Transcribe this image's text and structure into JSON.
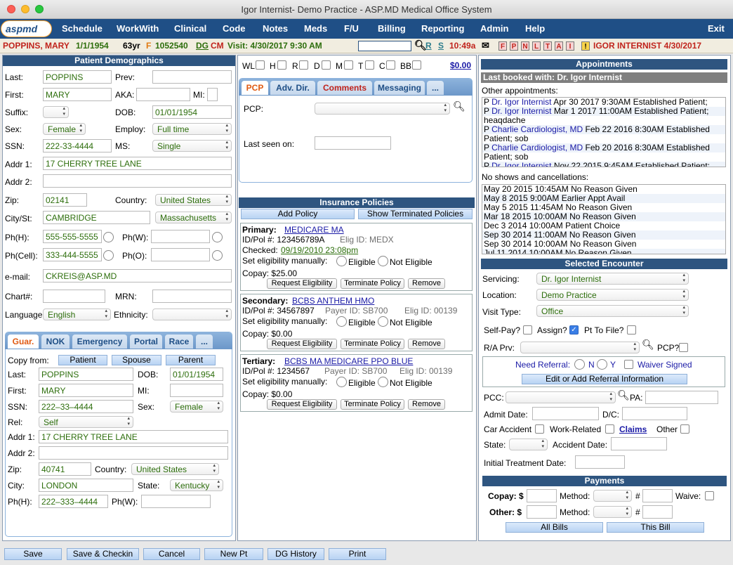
{
  "window": {
    "title": "Igor Internist- Demo Practice - ASP.MD Medical Office System"
  },
  "logo": {
    "text": "aspmd"
  },
  "nav": {
    "items": [
      "Schedule",
      "WorkWith",
      "Clinical",
      "Code",
      "Notes",
      "Meds",
      "F/U",
      "Billing",
      "Reporting",
      "Admin",
      "Help"
    ],
    "exit": "Exit"
  },
  "patient_strip": {
    "name": "POPPINS, MARY",
    "dob": "1/1/1954",
    "age": "63yr",
    "sex": "F",
    "id": "1052540",
    "dg": "DG",
    "cm": "CM",
    "visit": "Visit: 4/30/2017 9:30 AM",
    "r": "R",
    "s": "S",
    "time": "10:49a",
    "flags": [
      "F",
      "P",
      "N",
      "L",
      "T",
      "A",
      "I",
      "!"
    ],
    "provider": "IGOR INTERNIST 4/30/2017"
  },
  "demographics": {
    "header": "Patient Demographics",
    "labels": {
      "last": "Last:",
      "prev": "Prev:",
      "first": "First:",
      "aka": "AKA:",
      "mi": "MI:",
      "suffix": "Suffix:",
      "dob": "DOB:",
      "sex": "Sex:",
      "employ": "Employ:",
      "ssn": "SSN:",
      "ms": "MS:",
      "addr1": "Addr 1:",
      "addr2": "Addr 2:",
      "zip": "Zip:",
      "country": "Country:",
      "city": "City/St:",
      "phh": "Ph(H):",
      "phw": "Ph(W):",
      "phcell": "Ph(Cell):",
      "pho": "Ph(O):",
      "email": "e-mail:",
      "chart": "Chart#:",
      "mrn": "MRN:",
      "language": "Language",
      "ethnicity": "Ethnicity:"
    },
    "values": {
      "last": "POPPINS",
      "first": "MARY",
      "dob": "01/01/1954",
      "sex": "Female",
      "employ": "Full time",
      "ssn": "222-33-4444",
      "ms": "Single",
      "addr1": "17 CHERRY TREE LANE",
      "zip": "02141",
      "country": "United States",
      "city": "CAMBRIDGE",
      "state": "Massachusetts",
      "phh": "555-555-5555",
      "phcell": "333-444-5555",
      "email": "CKREIS@ASP.MD",
      "language": "English"
    }
  },
  "guarantor": {
    "tabs": [
      "Guar.",
      "NOK",
      "Emergency",
      "Portal",
      "Race",
      "..."
    ],
    "copy_from": "Copy from:",
    "copy_buttons": [
      "Patient",
      "Spouse",
      "Parent"
    ],
    "labels": {
      "last": "Last:",
      "dob": "DOB:",
      "first": "First:",
      "mi": "MI:",
      "ssn": "SSN:",
      "sex": "Sex:",
      "rel": "Rel:",
      "addr1": "Addr 1:",
      "addr2": "Addr 2:",
      "zip": "Zip:",
      "country": "Country:",
      "city": "City:",
      "state": "State:",
      "phh": "Ph(H):",
      "phw": "Ph(W):"
    },
    "values": {
      "last": "POPPINS",
      "dob": "01/01/1954",
      "first": "MARY",
      "ssn": "222–33–4444",
      "sex": "Female",
      "rel": "Self",
      "addr1": "17 CHERRY TREE LANE",
      "zip": "40741",
      "country": "United States",
      "city": "LONDON",
      "state": "Kentucky",
      "phh": "222–333–4444"
    }
  },
  "flags_row": {
    "items": [
      "WL",
      "H",
      "R",
      "D",
      "M",
      "T",
      "C",
      "BB"
    ],
    "amount": "$0.00"
  },
  "pcp_panel": {
    "tabs": [
      "PCP",
      "Adv. Dir.",
      "Comments",
      "Messaging",
      "..."
    ],
    "pcp_label": "PCP:",
    "last_seen": "Last seen on:"
  },
  "insurance": {
    "header": "Insurance Policies",
    "add": "Add Policy",
    "show_terminated": "Show Terminated Policies",
    "policies": [
      {
        "level": "Primary:",
        "name": "MEDICARE MA",
        "idpol": "ID/Pol #: 123456789A",
        "payer": "",
        "elig": "Elig ID: MEDX",
        "checked_label": "Checked:",
        "checked": "09/19/2010 23:08pm",
        "manual": "Set eligibility manually:",
        "eligible": "Eligible",
        "not_eligible": "Not Eligible",
        "copay": "Copay: $25.00",
        "buttons": [
          "Request Eligibility",
          "Terminate Policy",
          "Remove"
        ]
      },
      {
        "level": "Secondary:",
        "name": "BCBS ANTHEM HMO",
        "idpol": "ID/Pol #: 34567897",
        "payer": "Payer ID: SB700",
        "elig": "Elig ID: 00139",
        "manual": "Set eligibility manually:",
        "eligible": "Eligible",
        "not_eligible": "Not Eligible",
        "copay": "Copay: $0.00",
        "buttons": [
          "Request Eligibility",
          "Terminate Policy",
          "Remove"
        ]
      },
      {
        "level": "Tertiary:",
        "name": "BCBS MA MEDICARE PPO BLUE",
        "idpol": "ID/Pol #: 1234567",
        "payer": "Payer ID: SB700",
        "elig": "Elig ID: 00139",
        "manual": "Set eligibility manually:",
        "eligible": "Eligible",
        "not_eligible": "Not Eligible",
        "copay": "Copay: $0.00",
        "buttons": [
          "Request Eligibility",
          "Terminate Policy",
          "Remove"
        ]
      }
    ]
  },
  "appointments": {
    "header": "Appointments",
    "last_booked": "Last booked with: Dr. Igor Internist",
    "other_label": "Other appointments:",
    "other": [
      {
        "prefix": "P",
        "provider": "Dr. Igor Internist",
        "text": "Apr 30 2017 9:30AM Established Patient;"
      },
      {
        "prefix": "P",
        "provider": "Dr. Igor Internist",
        "text": "Mar 1 2017 11:00AM Established Patient;"
      },
      {
        "prefix": "",
        "provider": "",
        "text": "heaqdache"
      },
      {
        "prefix": "P",
        "provider": "Charlie Cardiologist, MD",
        "text": "Feb 22 2016 8:30AM Established"
      },
      {
        "prefix": "",
        "provider": "",
        "text": "Patient; sob"
      },
      {
        "prefix": "P",
        "provider": "Charlie Cardiologist, MD",
        "text": "Feb 20 2016 8:30AM Established"
      },
      {
        "prefix": "",
        "provider": "",
        "text": "Patient; sob"
      },
      {
        "prefix": "P",
        "provider": "Dr. Igor Internist",
        "text": "Nov 22 2015 9:45AM Established Patient;"
      }
    ],
    "noshow_label": "No shows and cancellations:",
    "noshows": [
      "May 20 2015 10:45AM No Reason Given",
      "May 8 2015 9:00AM Earlier Appt Avail",
      "May 5 2015 11:45AM No Reason Given",
      "Mar 18 2015 10:00AM No Reason Given",
      "Dec 3 2014 10:00AM Patient Choice",
      "Sep 30 2014 11:00AM No Reason Given",
      "Sep 30 2014 10:00AM No Reason Given",
      "Jul 11 2014 10:00AM No Reason Given"
    ]
  },
  "encounter": {
    "header": "Selected Encounter",
    "servicing_label": "Servicing:",
    "servicing": "Dr. Igor Internist",
    "location_label": "Location:",
    "location": "Demo Practice",
    "visit_type_label": "Visit Type:",
    "visit_type": "Office",
    "self_pay": "Self-Pay?",
    "assign": "Assign?",
    "pt_to_file": "Pt To File?",
    "ra_prv": "R/A Prv:",
    "pcp": "PCP?",
    "need_referral": "Need Referral:",
    "n": "N",
    "y": "Y",
    "waiver": "Waiver Signed",
    "referral_btn": "Edit or Add Referral Information",
    "pcc": "PCC:",
    "pa": "PA:",
    "admit": "Admit Date:",
    "dc": "D/C:",
    "car_accident": "Car Accident",
    "work_related": "Work-Related",
    "claims": "Claims",
    "other": "Other",
    "state": "State:",
    "accident_date": "Accident Date:",
    "initial_treatment": "Initial Treatment Date:"
  },
  "payments": {
    "header": "Payments",
    "copay": "Copay: $",
    "method": "Method:",
    "hash": "#",
    "waive": "Waive:",
    "other": "Other: $",
    "all_bills": "All Bills",
    "this_bill": "This Bill"
  },
  "bottom": {
    "buttons": [
      "Save",
      "Save & Checkin",
      "Cancel",
      "New Pt",
      "DG History",
      "Print"
    ]
  },
  "colors": {
    "nav": "#1f4f86",
    "panel_header": "#2e5580",
    "patient_name": "#c0231c",
    "accent_orange": "#e05a12",
    "value_green": "#2d6e0c"
  }
}
